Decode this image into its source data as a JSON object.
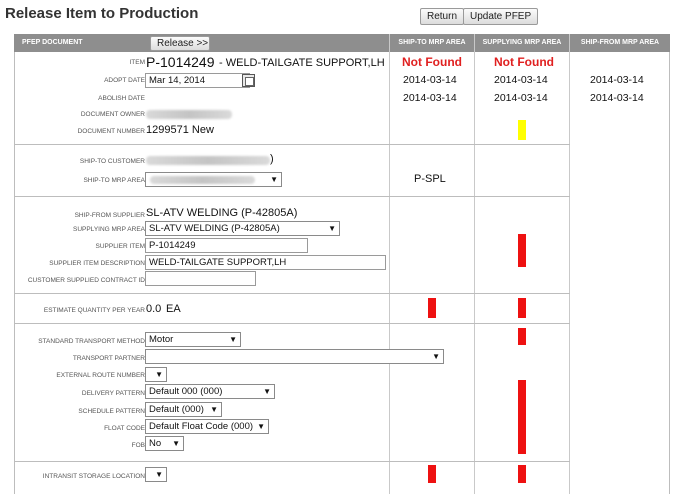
{
  "page": {
    "title": "Release Item to Production",
    "return_label": "Return",
    "update_label": "Update PFEP"
  },
  "header": {
    "pfep_document": "PFEP DOCUMENT",
    "release_label": "Release >>",
    "ship_to_mrp_area": "SHIP-TO MRP AREA",
    "supplying_mrp_area": "SUPPLYING MRP AREA",
    "ship_from_mrp_area": "SHIP-FROM MRP AREA"
  },
  "labels": {
    "item": "ITEM",
    "adopt_date": "ADOPT DATE",
    "abolish_date": "ABOLISH DATE",
    "document_owner": "DOCUMENT OWNER",
    "document_number": "DOCUMENT NUMBER",
    "ship_to_customer": "SHIP-TO CUSTOMER",
    "ship_to_mrp_area": "SHIP-TO MRP AREA",
    "ship_from_supplier": "SHIP-FROM SUPPLIER",
    "supplying_mrp_area": "SUPPLYING MRP AREA",
    "supplier_item": "SUPPLIER ITEM",
    "supplier_item_description": "SUPPLIER ITEM DESCRIPTION",
    "customer_supplied_contract_id": "CUSTOMER SUPPLIED CONTRACT ID",
    "estimate_quantity_per_year": "ESTIMATE QUANTITY PER YEAR",
    "standard_transport_method": "STANDARD TRANSPORT METHOD",
    "transport_partner": "TRANSPORT PARTNER",
    "external_route_number": "EXTERNAL ROUTE NUMBER",
    "delivery_pattern": "DELIVERY PATTERN",
    "schedule_pattern": "SCHEDULE PATTERN",
    "float_code": "FLOAT CODE",
    "fob": "FOB",
    "intransit_storage_location": "INTRANSIT STORAGE LOCATION"
  },
  "values": {
    "item_number": "P-1014249",
    "item_description": "- WELD-TAILGATE SUPPORT,LH",
    "adopt_date": "Mar 14, 2014",
    "document_number": "1299571 New",
    "ship_from_supplier": "SL-ATV WELDING (P-42805A)",
    "supplying_mrp_area": "SL-ATV WELDING (P-42805A)",
    "supplier_item": "P-1014249",
    "supplier_item_description": "WELD-TAILGATE SUPPORT,LH",
    "customer_supplied_contract_id": "",
    "estimate_quantity": "0.0",
    "estimate_unit": "EA",
    "standard_transport_method": "Motor",
    "transport_partner": "",
    "external_route_number": "",
    "delivery_pattern": "Default 000 (000)",
    "schedule_pattern": "Default (000)",
    "float_code": "Default Float Code (000)",
    "fob": "No",
    "intransit_storage_location": ""
  },
  "ship_to": {
    "status": "Not Found",
    "adopt_date": "2014-03-14",
    "abolish_date": "2014-03-14",
    "mrp_area_code": "P-SPL"
  },
  "supplying": {
    "status": "Not Found",
    "adopt_date": "2014-03-14",
    "abolish_date": "2014-03-14"
  },
  "ship_from": {
    "adopt_date": "2014-03-14",
    "abolish_date": "2014-03-14"
  },
  "colors": {
    "header_bg": "#8e8e8e",
    "not_found": "#e02020",
    "flag_red": "#ee1111",
    "flag_yellow": "#ffff00"
  }
}
